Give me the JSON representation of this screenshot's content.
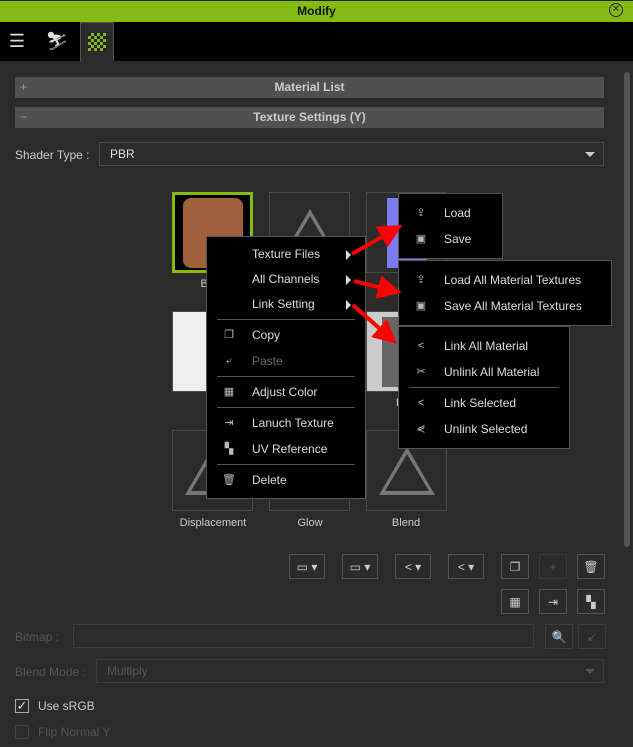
{
  "window": {
    "title": "Modify"
  },
  "tabs": [
    {
      "icon": "sliders-icon"
    },
    {
      "icon": "motion-icon"
    },
    {
      "icon": "texture-checker-icon",
      "active": true
    }
  ],
  "sections": {
    "material_list": "Material List",
    "texture_settings": "Texture Settings  (Y)",
    "expand_sign": "+",
    "collapse_sign": "−"
  },
  "shader": {
    "label": "Shader Type :",
    "value": "PBR"
  },
  "thumbnails": [
    {
      "label": "Base",
      "selected": true
    },
    {
      "label": ""
    },
    {
      "label": "E"
    },
    {
      "label": ""
    },
    {
      "label": ""
    },
    {
      "label": "Rou"
    },
    {
      "label": "Displacement"
    },
    {
      "label": "Glow"
    },
    {
      "label": "Blend"
    }
  ],
  "context_menu": {
    "items": [
      "Texture Files",
      "All Channels",
      "Link Setting",
      "Copy",
      "Paste",
      "Adjust Color",
      "Lanuch Texture",
      "UV Reference",
      "Delete"
    ]
  },
  "submenu_texture_files": [
    "Load",
    "Save"
  ],
  "submenu_all_channels": [
    "Load All Material Textures",
    "Save All Material Textures"
  ],
  "submenu_link_setting": [
    "Link All Material",
    "Unlink All Material",
    "Link Selected",
    "Unlink Selected"
  ],
  "bitmap": {
    "label": "Bitmap :",
    "value": ""
  },
  "blend_mode": {
    "label": "Blend Mode :",
    "value": "Multiply"
  },
  "use_srgb": {
    "label": "Use sRGB",
    "checked": true
  },
  "flip_normal": {
    "label": "Flip Normal Y",
    "checked": false
  },
  "colors": {
    "accent": "#84bb12",
    "arrow": "#ff0000"
  }
}
